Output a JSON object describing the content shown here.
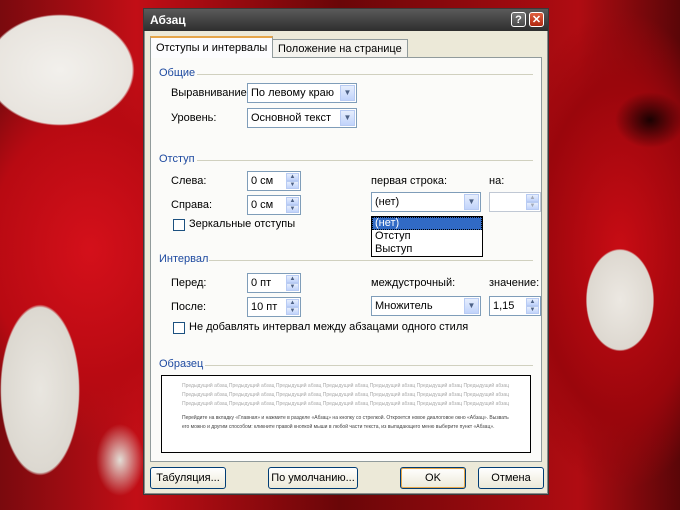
{
  "dialog": {
    "title": "Абзац",
    "help": "?",
    "close": "✕"
  },
  "tabs": [
    {
      "label": "Отступы и интервалы",
      "active": true
    },
    {
      "label": "Положение на странице",
      "active": false
    }
  ],
  "general": {
    "title": "Общие",
    "alignment_label": "Выравнивание:",
    "alignment_value": "По левому краю",
    "level_label": "Уровень:",
    "level_value": "Основной текст"
  },
  "indent": {
    "title": "Отступ",
    "left_label": "Слева:",
    "left_value": "0 см",
    "right_label": "Справа:",
    "right_value": "0 см",
    "first_line_label": "первая строка:",
    "first_line_value": "(нет)",
    "by_label": "на:",
    "by_value": "",
    "mirror_label": "Зеркальные отступы",
    "first_line_options": [
      "(нет)",
      "Отступ",
      "Выступ"
    ]
  },
  "spacing": {
    "title": "Интервал",
    "before_label": "Перед:",
    "before_value": "0 пт",
    "after_label": "После:",
    "after_value": "10 пт",
    "line_label": "междустрочный:",
    "line_value": "Множитель",
    "at_label": "значение:",
    "at_value": "1,15",
    "no_space_label": "Не добавлять интервал между абзацами одного стиля"
  },
  "preview": {
    "title": "Образец",
    "prev_lines": [
      "Предыдущий абзац Предыдущий абзац Предыдущий абзац Предыдущий абзац Предыдущий абзац Предыдущий абзац Предыдущий абзац",
      "Предыдущий абзац Предыдущий абзац Предыдущий абзац Предыдущий абзац Предыдущий абзац Предыдущий абзац Предыдущий абзац",
      "Предыдущий абзац Предыдущий абзац Предыдущий абзац Предыдущий абзац Предыдущий абзац Предыдущий абзац Предыдущий абзац"
    ],
    "sample_text": "Перейдите на вкладку «Главная» и нажмите в разделе «Абзац» на кнопку со стрелкой. Откроется новое диалоговое окно «Абзац». Вызвать его можно и другим способом: кликните правой кнопкой мыши в любой части текста, из выпадающего меню выберите пункт «Абзац»."
  },
  "buttons": {
    "tabs": "Табуляция...",
    "default": "По умолчанию...",
    "ok": "OK",
    "cancel": "Отмена"
  }
}
